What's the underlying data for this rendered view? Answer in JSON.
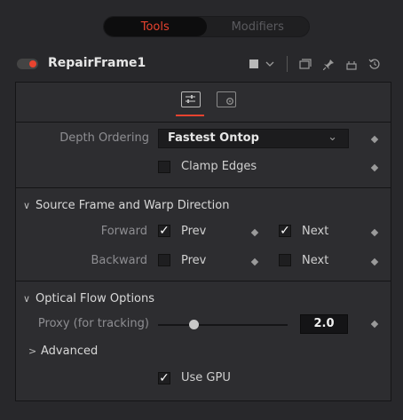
{
  "tabs": {
    "tools": "Tools",
    "modifiers": "Modifiers"
  },
  "node": {
    "name": "RepairFrame1"
  },
  "header_icons": [
    "color-swatch-icon",
    "chevron-down-icon",
    "view-icon",
    "pin-icon",
    "lock-icon",
    "reset-icon"
  ],
  "controls": {
    "depth_ordering_label": "Depth Ordering",
    "depth_ordering_value": "Fastest Ontop",
    "clamp_edges_label": "Clamp Edges",
    "clamp_edges_checked": false
  },
  "section_source": {
    "title": "Source Frame and Warp Direction",
    "forward_label": "Forward",
    "backward_label": "Backward",
    "prev_label": "Prev",
    "next_label": "Next",
    "forward_prev_checked": true,
    "forward_next_checked": true,
    "backward_prev_checked": false,
    "backward_next_checked": false
  },
  "section_optical": {
    "title": "Optical Flow Options",
    "proxy_label": "Proxy (for tracking)",
    "proxy_value": "2.0",
    "advanced_label": "Advanced",
    "use_gpu_label": "Use GPU",
    "use_gpu_checked": true
  },
  "colors": {
    "accent": "#e8432f",
    "panel": "#2d2d30",
    "background": "#28282b"
  }
}
